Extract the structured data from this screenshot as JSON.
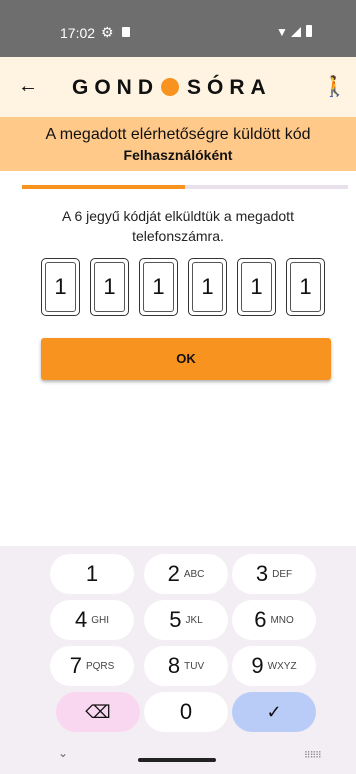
{
  "status_bar": {
    "time": "17:02",
    "gear_icon": "gear-icon",
    "sd_icon": "sd-card-icon"
  },
  "app_bar": {
    "logo_left": "GOND",
    "logo_right": "SÓRA",
    "logo_dot_color": "#f7931e"
  },
  "banner": {
    "title": "A megadott elérhetőségre küldött kód",
    "subtitle": "Felhasználóként"
  },
  "progress": {
    "value_fraction": 0.5
  },
  "message": "A 6 jegyű kódját elküldtük a megadott telefonszámra.",
  "code_digits": [
    "1",
    "1",
    "1",
    "1",
    "1",
    "1"
  ],
  "ok_button": {
    "label": "OK"
  },
  "keypad": {
    "keys": [
      {
        "num": "1",
        "letters": ""
      },
      {
        "num": "2",
        "letters": "ABC"
      },
      {
        "num": "3",
        "letters": "DEF"
      },
      {
        "num": "4",
        "letters": "GHI"
      },
      {
        "num": "5",
        "letters": "JKL"
      },
      {
        "num": "6",
        "letters": "MNO"
      },
      {
        "num": "7",
        "letters": "PQRS"
      },
      {
        "num": "8",
        "letters": "TUV"
      },
      {
        "num": "9",
        "letters": "WXYZ"
      }
    ],
    "zero": "0",
    "backspace_icon": "backspace-icon",
    "done_icon": "checkmark-icon"
  },
  "colors": {
    "accent": "#f7931e",
    "banner_bg": "#ffc98a",
    "appbar_bg": "#fff4e2"
  }
}
